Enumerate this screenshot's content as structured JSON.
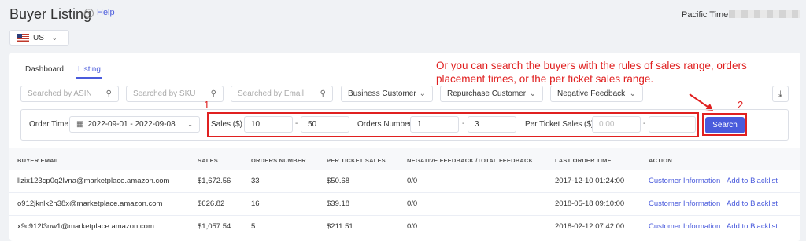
{
  "header": {
    "title": "Buyer Listing",
    "help": "Help",
    "pacific_time_label": "Pacific Time :",
    "region": "US"
  },
  "tabs": [
    "Dashboard",
    "Listing"
  ],
  "filters_row1": {
    "asin_placeholder": "Searched by ASIN",
    "sku_placeholder": "Searched by SKU",
    "email_placeholder": "Searched by Email",
    "business_customer": "Business Customer",
    "repurchase_customer": "Repurchase Customer",
    "negative_feedback": "Negative Feedback"
  },
  "filters_row2": {
    "order_time_label": "Order Time",
    "order_time_value": "2022-09-01 - 2022-09-08",
    "sales_label": "Sales ($)",
    "sales_min": "10",
    "sales_max": "50",
    "orders_label": "Orders Number",
    "orders_min": "1",
    "orders_max": "3",
    "per_ticket_label": "Per Ticket Sales ($)",
    "per_ticket_min_placeholder": "0.00",
    "per_ticket_max": "",
    "dash": "-",
    "search_button": "Search"
  },
  "annotation": {
    "text": "Or you can search the buyers with the rules of sales range, orders placement times, or the per ticket sales range.",
    "num1": "1",
    "num2": "2"
  },
  "table": {
    "columns": [
      "BUYER EMAIL",
      "SALES",
      "ORDERS NUMBER",
      "PER TICKET SALES",
      "NEGATIVE FEEDBACK /TOTAL FEEDBACK",
      "LAST ORDER TIME",
      "ACTION"
    ],
    "rows": [
      {
        "email": "llzix123cp0q2lvna@marketplace.amazon.com",
        "sales": "$1,672.56",
        "orders": "33",
        "per_ticket": "$50.68",
        "feedback": "0/0",
        "last_order": "2017-12-10 01:24:00",
        "action1": "Customer Information",
        "action2": "Add to Blacklist"
      },
      {
        "email": "o912jknlk2h38x@marketplace.amazon.com",
        "sales": "$626.82",
        "orders": "16",
        "per_ticket": "$39.18",
        "feedback": "0/0",
        "last_order": "2018-05-18 09:10:00",
        "action1": "Customer Information",
        "action2": "Add to Blacklist"
      },
      {
        "email": "x9c912l3nw1@marketplace.amazon.com",
        "sales": "$1,057.54",
        "orders": "5",
        "per_ticket": "$211.51",
        "feedback": "0/0",
        "last_order": "2018-02-12 07:42:00",
        "action1": "Customer Information",
        "action2": "Add to Blacklist"
      }
    ]
  },
  "colors": {
    "accent": "#4a5bdc",
    "annotation": "#e02020"
  }
}
